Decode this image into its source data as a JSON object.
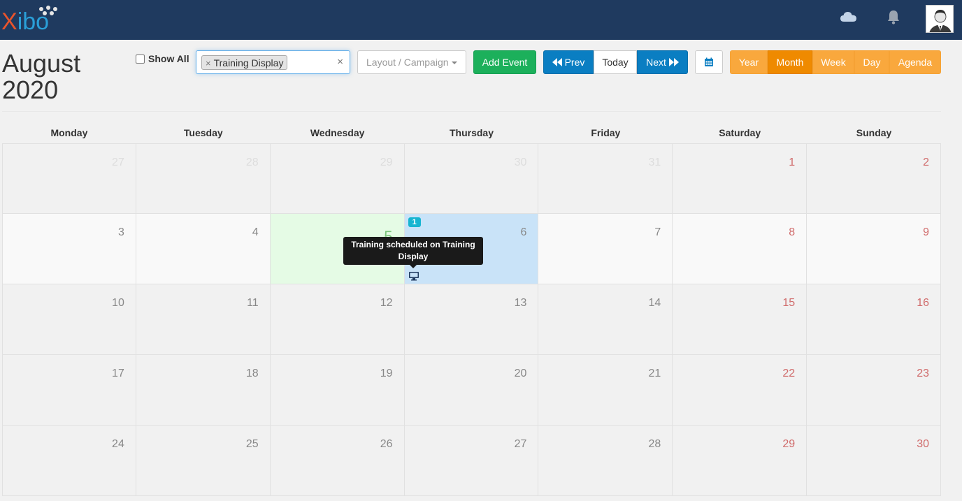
{
  "header": {
    "logo_x": "X",
    "logo_rest": "ibo",
    "cloud_icon": "cloud-icon",
    "bell_icon": "bell-icon",
    "avatar_icon": "user-avatar-icon"
  },
  "title": {
    "line1": "August",
    "line2": "2020"
  },
  "toolbar": {
    "show_all_label": "Show All",
    "display_tag": "Training Display",
    "tag_remove": "×",
    "clear": "×",
    "layout_placeholder": "Layout / Campaign",
    "add_event_label": "Add Event",
    "prev_label": "Prev",
    "today_label": "Today",
    "next_label": "Next",
    "calendar_icon": "calendar-icon"
  },
  "views": [
    "Year",
    "Month",
    "Week",
    "Day",
    "Agenda"
  ],
  "active_view": "Month",
  "weekdays": [
    "Monday",
    "Tuesday",
    "Wednesday",
    "Thursday",
    "Friday",
    "Saturday",
    "Sunday"
  ],
  "weeks": [
    [
      "27",
      "28",
      "29",
      "30",
      "31",
      "1",
      "2"
    ],
    [
      "3",
      "4",
      "5",
      "6",
      "7",
      "8",
      "9"
    ],
    [
      "10",
      "11",
      "12",
      "13",
      "14",
      "15",
      "16"
    ],
    [
      "17",
      "18",
      "19",
      "20",
      "21",
      "22",
      "23"
    ],
    [
      "24",
      "25",
      "26",
      "27",
      "28",
      "29",
      "30"
    ]
  ],
  "event": {
    "count": "1",
    "tooltip": "Training scheduled on Training Display",
    "icon": "display-icon"
  },
  "colors": {
    "navbar": "#1f3a5f",
    "add_event": "#1cb05b",
    "nav_buttons": "#0a7ec2",
    "view_buttons": "#f9a83d",
    "active_view": "#ef8a00",
    "today_cell": "#e5fbe5",
    "event_cell": "#c9e3f8",
    "badge": "#17b5d1"
  }
}
